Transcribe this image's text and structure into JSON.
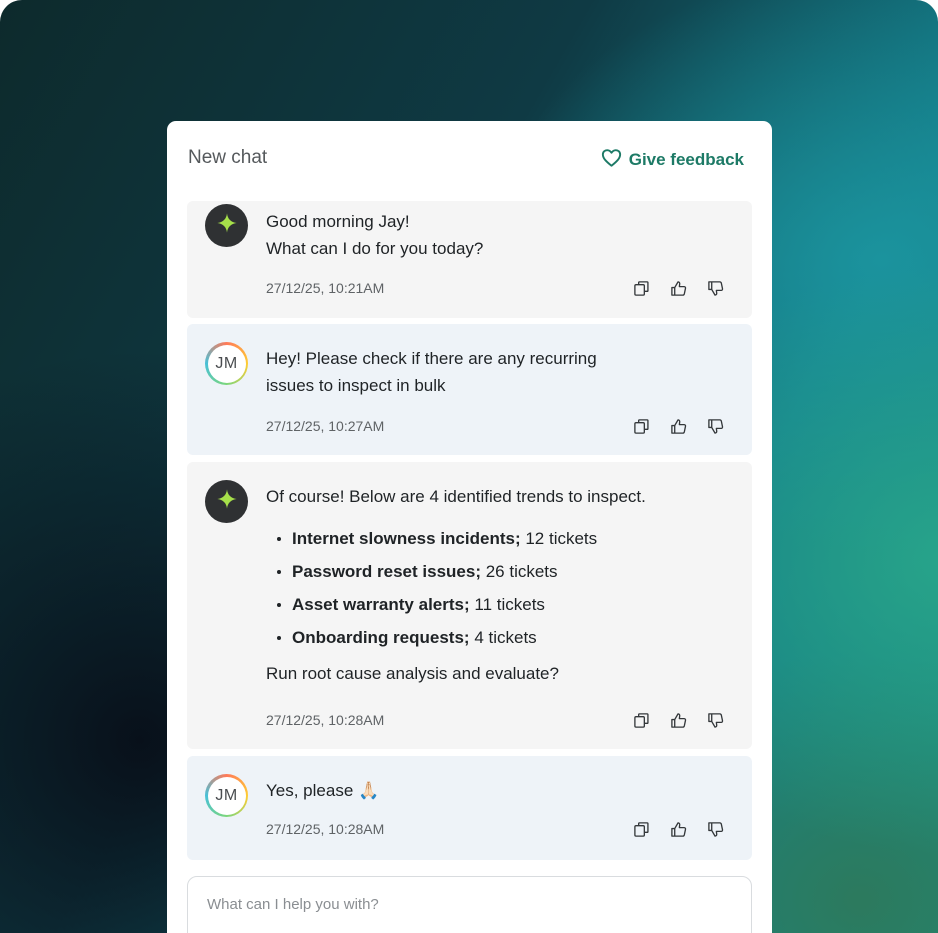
{
  "panel": {
    "title": "New chat",
    "feedback_label": "Give feedback"
  },
  "messages": [
    {
      "role": "assistant",
      "lines": [
        "Good morning Jay!",
        "What can I do for you today?"
      ],
      "timestamp": "27/12/25, 10:21AM"
    },
    {
      "role": "user",
      "avatar_initials": "JM",
      "lines": [
        "Hey! Please check if there are any recurring",
        "issues to inspect in bulk"
      ],
      "timestamp": "27/12/25, 10:27AM"
    },
    {
      "role": "assistant",
      "intro": "Of course! Below are 4 identified trends to inspect.",
      "trends": [
        {
          "title": "Internet slowness incidents;",
          "count": "12 tickets"
        },
        {
          "title": "Password reset issues;",
          "count": "26 tickets"
        },
        {
          "title": "Asset warranty alerts;",
          "count": "11 tickets"
        },
        {
          "title": "Onboarding requests;",
          "count": "4 tickets"
        }
      ],
      "outro": "Run root cause analysis and evaluate?",
      "timestamp": "27/12/25, 10:28AM"
    },
    {
      "role": "user",
      "avatar_initials": "JM",
      "lines": [
        "Yes, please 🙏🏻"
      ],
      "timestamp": "27/12/25, 10:28AM"
    }
  ],
  "composer": {
    "placeholder": "What can I help you with?",
    "value": ""
  },
  "icons": {
    "assistant_avatar": "sparkle-icon",
    "feedback": "heart-icon",
    "message_actions": [
      "copy-icon",
      "thumbs-up-icon",
      "thumbs-down-icon"
    ]
  },
  "colors": {
    "accent": "#1d7a66",
    "sparkle": "#a6e04a",
    "ai_bubble": "#f5f5f5",
    "user_bubble": "#eef3f8"
  }
}
